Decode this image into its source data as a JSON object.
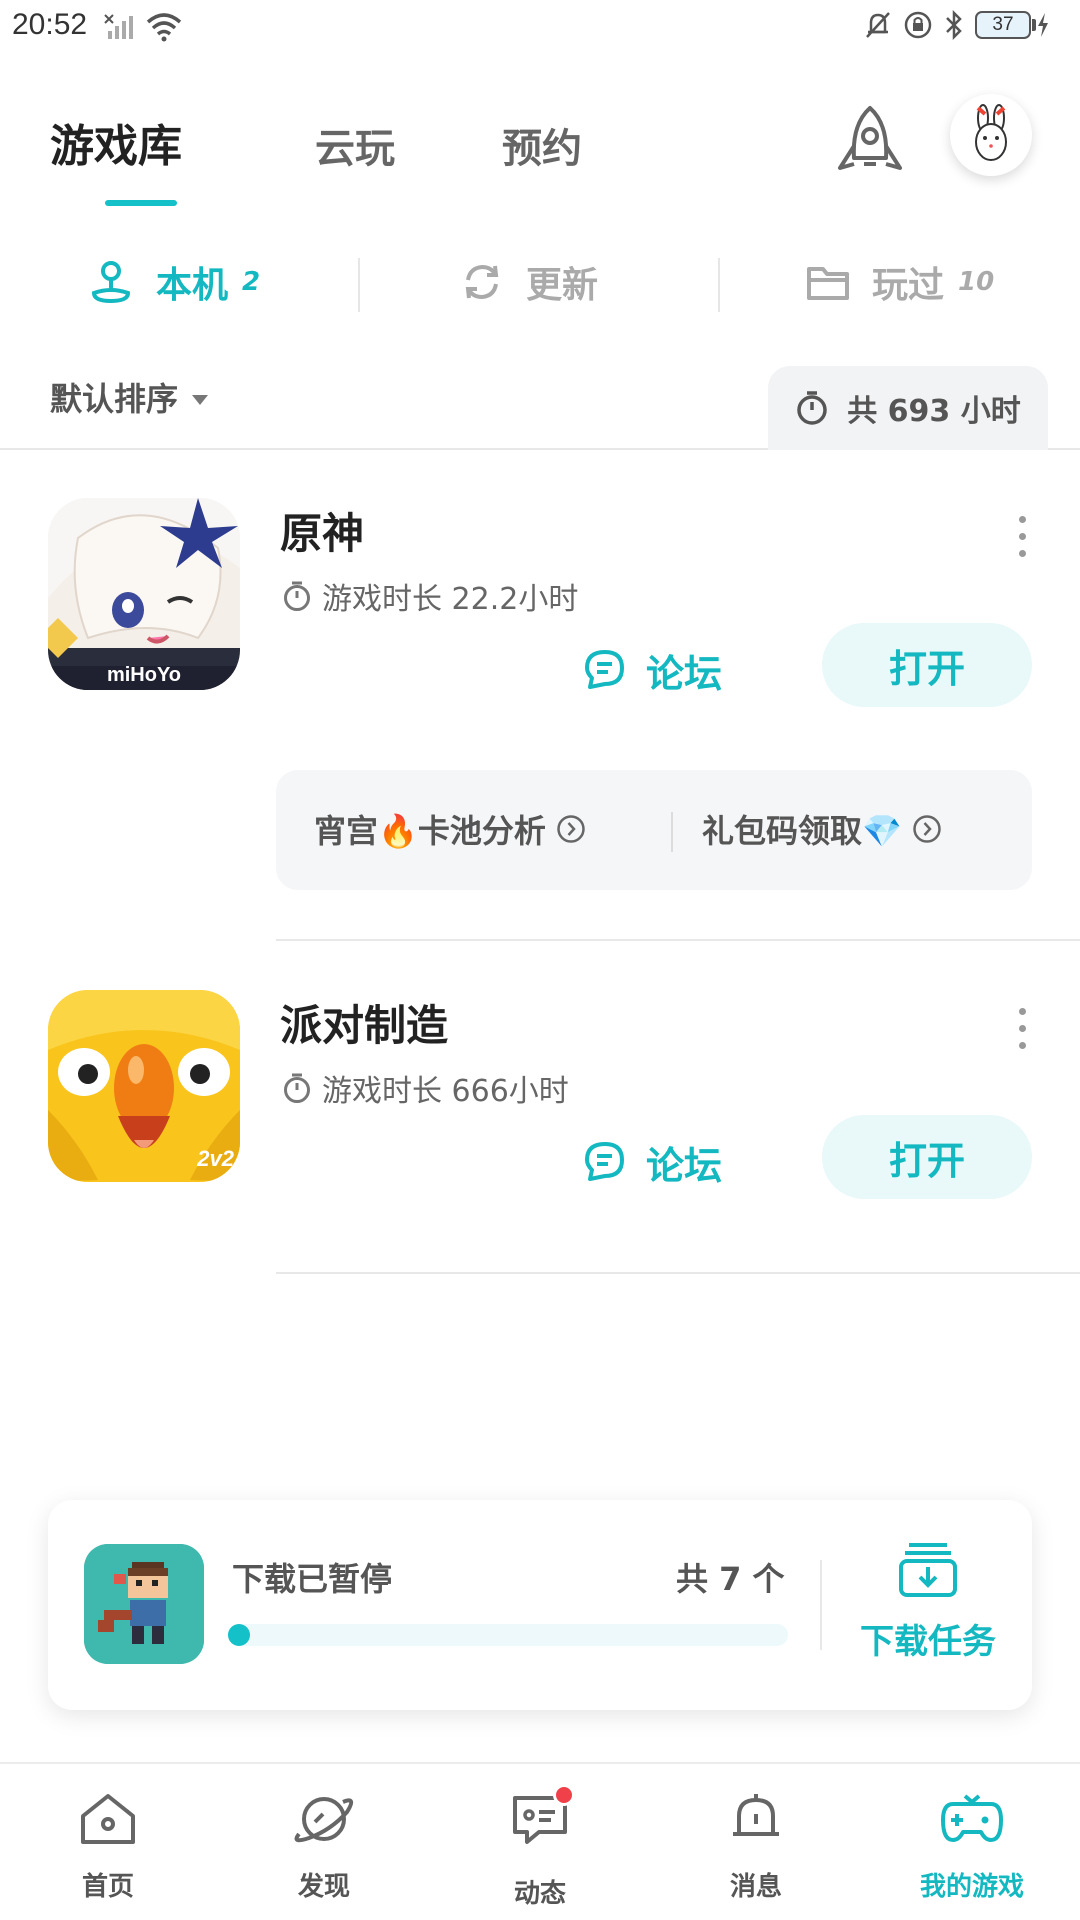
{
  "status_bar": {
    "time": "20:52",
    "battery": "37"
  },
  "header": {
    "tabs": [
      {
        "label": "游戏库"
      },
      {
        "label": "云玩"
      },
      {
        "label": "预约"
      }
    ]
  },
  "sub_tabs": [
    {
      "label": "本机",
      "count": "2"
    },
    {
      "label": "更新"
    },
    {
      "label": "玩过",
      "count": "10"
    }
  ],
  "sort": {
    "label": "默认排序",
    "total_time": "共 693 小时"
  },
  "games": [
    {
      "name": "原神",
      "play_time": "游戏时长 22.2小时",
      "forum_label": "论坛",
      "open_label": "打开",
      "icon_text": "miHoYo",
      "links": [
        {
          "label": "宵宫🔥卡池分析"
        },
        {
          "label": "礼包码领取💎"
        }
      ]
    },
    {
      "name": "派对制造",
      "play_time": "游戏时长 666小时",
      "forum_label": "论坛",
      "open_label": "打开",
      "icon_text": "2v2"
    }
  ],
  "download": {
    "status": "下载已暂停",
    "count": "共 7 个",
    "progress": 0.02,
    "task_label": "下载任务"
  },
  "bottom_nav": [
    {
      "label": "首页",
      "icon": "home-icon"
    },
    {
      "label": "发现",
      "icon": "planet-icon"
    },
    {
      "label": "动态",
      "icon": "chat-icon"
    },
    {
      "label": "消息",
      "icon": "bell-icon"
    },
    {
      "label": "我的游戏",
      "icon": "gamepad-icon"
    }
  ],
  "colors": {
    "accent": "#14c1c9",
    "badge": "#f0414a"
  }
}
